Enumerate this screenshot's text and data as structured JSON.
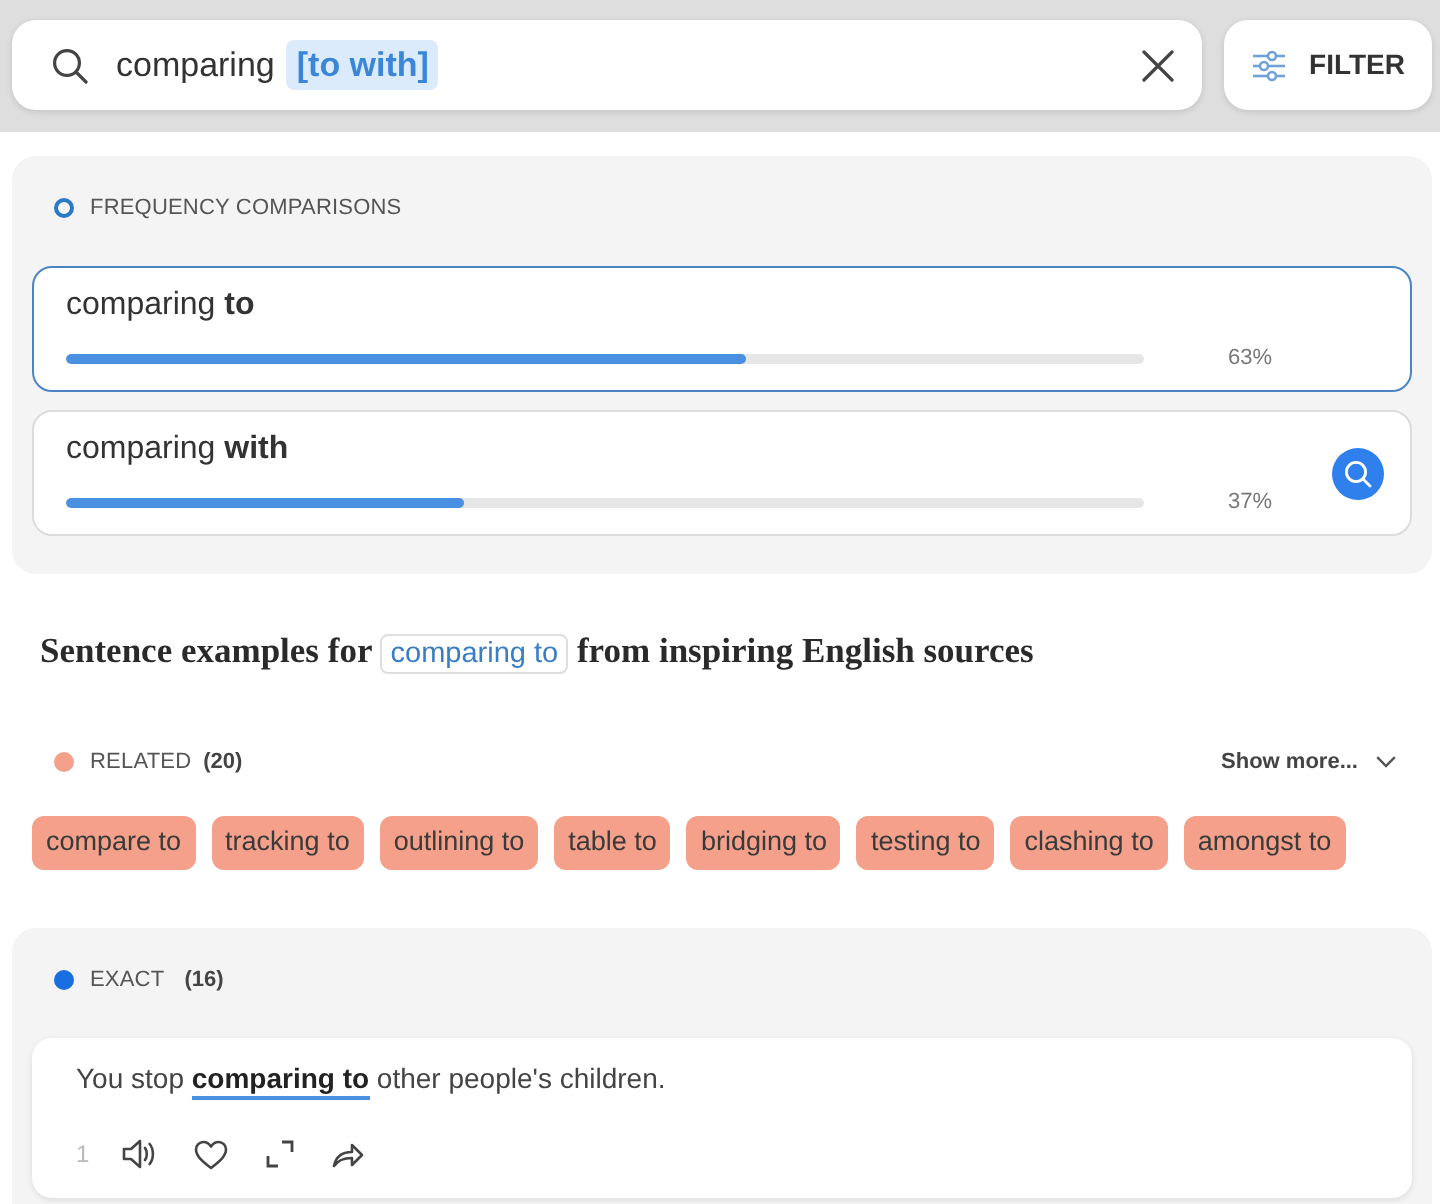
{
  "search": {
    "query": "comparing",
    "highlight": "[to with]"
  },
  "filter_button": {
    "label": "FILTER"
  },
  "frequency": {
    "title": "FREQUENCY COMPARISONS",
    "items": [
      {
        "phrase": "comparing **to**",
        "level": 0.63,
        "percent": "63%",
        "selected": true,
        "hovered": false
      },
      {
        "phrase": "comparing **with**",
        "level": 0.37,
        "percent": "37%",
        "selected": false,
        "hovered": true
      }
    ]
  },
  "heading": {
    "before": "Sentence examples for",
    "phrase": "comparing to",
    "after": "from inspiring English sources"
  },
  "related": {
    "title": "RELATED",
    "count": "(20)",
    "color": "#f4a08a",
    "show_more": "Show more...",
    "tags": [
      "compare to",
      "tracking to",
      "outlining to",
      "table to",
      "bridging to",
      "testing to",
      "clashing to",
      "amongst to"
    ]
  },
  "exact": {
    "title": "EXACT",
    "count": "(16)",
    "color": "#1a6fe0",
    "examples": [
      {
        "number": "1",
        "sentence": "You stop **comparing to** other people's children."
      }
    ]
  }
}
